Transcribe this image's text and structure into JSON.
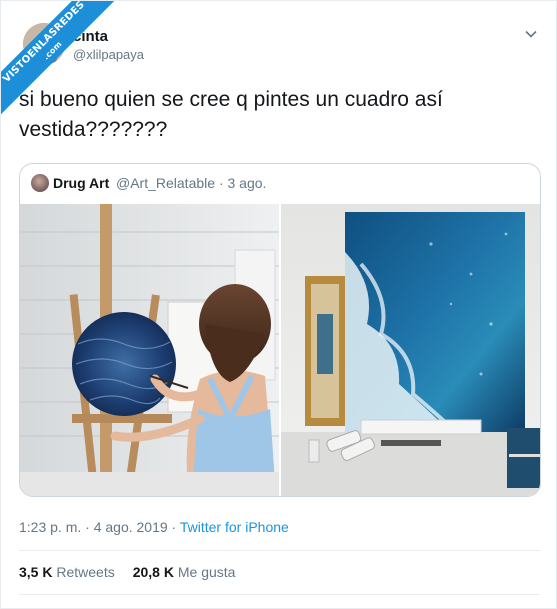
{
  "watermark": {
    "line1": "VISTOENLASREDES",
    "line2": ".com"
  },
  "user": {
    "name": "cinta",
    "handle": "@xlilpapaya"
  },
  "tweet": {
    "text": "si bueno quien se cree q pintes un cuadro así vestida???????"
  },
  "quoted": {
    "name": "Drug Art",
    "handle": "@Art_Relatable",
    "separator": "·",
    "date": "3 ago."
  },
  "meta": {
    "time": "1:23 p. m. · 4 ago. 2019",
    "separator": " · ",
    "source": "Twitter for iPhone"
  },
  "stats": {
    "retweets_count": "3,5 K",
    "retweets_label": "Retweets",
    "likes_count": "20,8 K",
    "likes_label": "Me gusta"
  },
  "colors": {
    "accent": "#1b95e0",
    "muted": "#657786",
    "border": "#ccd6dd"
  }
}
